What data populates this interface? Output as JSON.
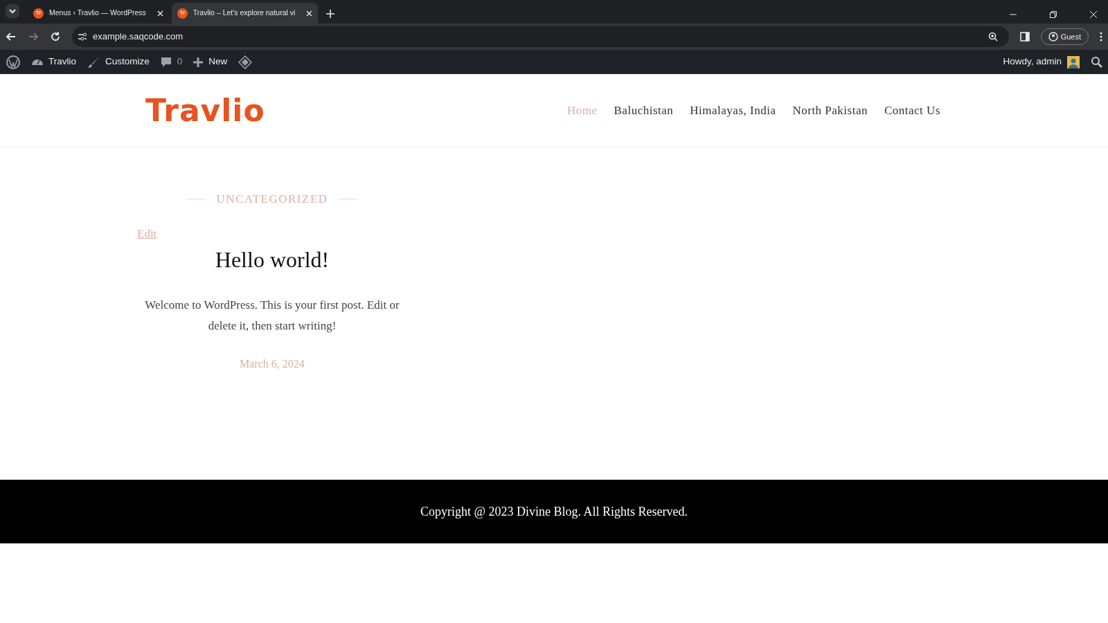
{
  "browser": {
    "tabs": [
      {
        "favicon_text": "Tr",
        "title": "Menus ‹ Travlio — WordPress",
        "selected": false
      },
      {
        "favicon_text": "Tr",
        "title": "Travlio – Let's explore natural vi",
        "selected": true
      }
    ],
    "address": "example.saqcode.com",
    "profile": "Guest"
  },
  "admin_bar": {
    "items": [
      {
        "kind": "logo"
      },
      {
        "kind": "site",
        "label": "Travlio"
      },
      {
        "kind": "customize",
        "label": "Customize"
      },
      {
        "kind": "comments",
        "label": "0"
      },
      {
        "kind": "new",
        "label": "New"
      },
      {
        "kind": "plugin"
      }
    ],
    "greeting": "Howdy, admin"
  },
  "site": {
    "logo": "Travlio",
    "nav": [
      {
        "label": "Home",
        "selected": true
      },
      {
        "label": "Baluchistan",
        "selected": false
      },
      {
        "label": "Himalayas, India",
        "selected": false
      },
      {
        "label": "North Pakistan",
        "selected": false
      },
      {
        "label": "Contact Us",
        "selected": false
      }
    ]
  },
  "post": {
    "category": "UNCATEGORIZED",
    "edit": "Edit",
    "title": "Hello world!",
    "excerpt": "Welcome to WordPress. This is your first post. Edit or delete it, then start writing!",
    "date": "March 6, 2024"
  },
  "footer": {
    "copyright": "Copyright @ 2023 Divine Blog. All Rights Reserved."
  }
}
